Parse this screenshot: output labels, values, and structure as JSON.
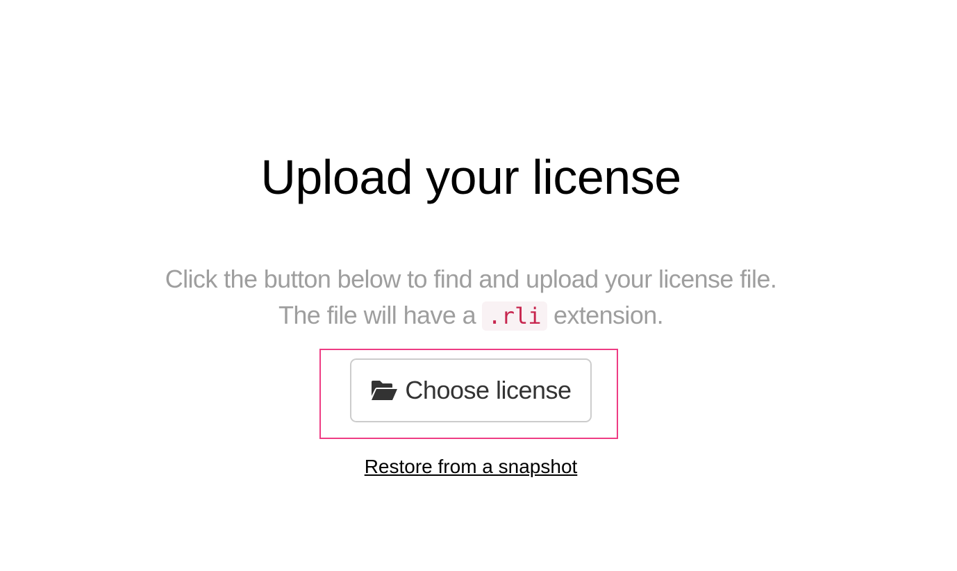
{
  "page": {
    "title": "Upload your license",
    "description_line1": "Click the button below to find and upload your license file.",
    "description_line2_before": "The file will have a ",
    "description_code": ".rli",
    "description_line2_after": " extension."
  },
  "actions": {
    "choose_label": "Choose license",
    "choose_icon": "folder-open-icon",
    "restore_label": "Restore from a snapshot"
  },
  "colors": {
    "highlight_border": "#ee3b83",
    "code_text": "#c7254e",
    "code_background": "#f9f2f4",
    "muted_text": "#9e9e9e"
  }
}
